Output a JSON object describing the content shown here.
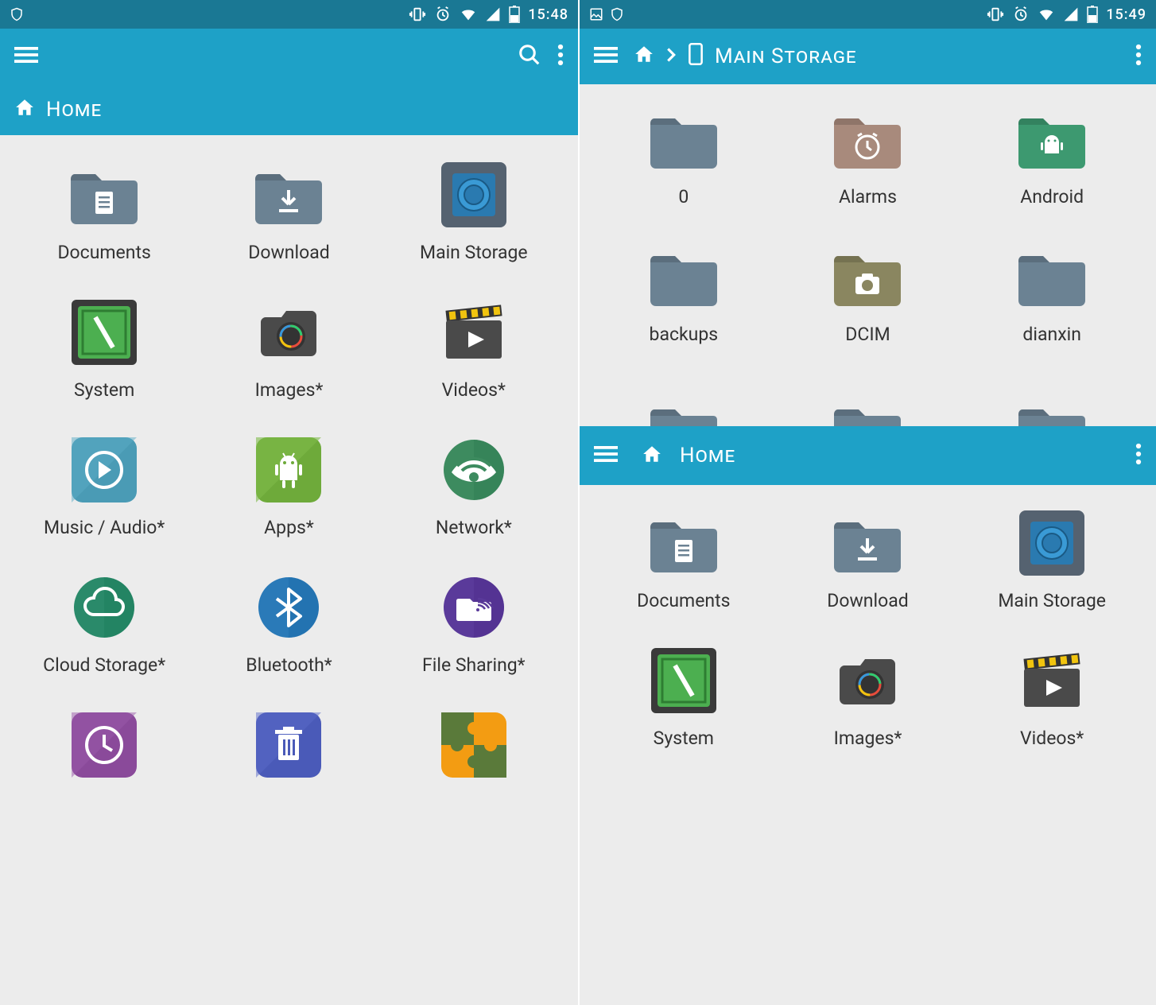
{
  "phone1": {
    "status_time": "15:48",
    "title": "Home",
    "items": [
      {
        "label": "Documents",
        "icon": "folder-doc"
      },
      {
        "label": "Download",
        "icon": "folder-download"
      },
      {
        "label": "Main Storage",
        "icon": "storage"
      },
      {
        "label": "System",
        "icon": "system"
      },
      {
        "label": "Images*",
        "icon": "images"
      },
      {
        "label": "Videos*",
        "icon": "videos"
      },
      {
        "label": "Music / Audio*",
        "icon": "music"
      },
      {
        "label": "Apps*",
        "icon": "apps"
      },
      {
        "label": "Network*",
        "icon": "network"
      },
      {
        "label": "Cloud Storage*",
        "icon": "cloud"
      },
      {
        "label": "Bluetooth*",
        "icon": "bluetooth"
      },
      {
        "label": "File Sharing*",
        "icon": "sharing"
      },
      {
        "label": "",
        "icon": "recent"
      },
      {
        "label": "",
        "icon": "trash"
      },
      {
        "label": "",
        "icon": "plugins"
      }
    ]
  },
  "phone2": {
    "status_time": "15:49",
    "breadcrumb_current": "Main Storage",
    "top_items": [
      {
        "label": "0",
        "icon": "folder"
      },
      {
        "label": "Alarms",
        "icon": "folder-alarm"
      },
      {
        "label": "Android",
        "icon": "folder-android"
      },
      {
        "label": "backups",
        "icon": "folder"
      },
      {
        "label": "DCIM",
        "icon": "folder-dcim"
      },
      {
        "label": "dianxin",
        "icon": "folder"
      },
      {
        "label": "",
        "icon": "folder-partial"
      },
      {
        "label": "",
        "icon": "folder-partial"
      },
      {
        "label": "",
        "icon": "folder-partial"
      }
    ],
    "bottom_title": "Home",
    "bottom_items": [
      {
        "label": "Documents",
        "icon": "folder-doc"
      },
      {
        "label": "Download",
        "icon": "folder-download"
      },
      {
        "label": "Main Storage",
        "icon": "storage"
      },
      {
        "label": "System",
        "icon": "system"
      },
      {
        "label": "Images*",
        "icon": "images"
      },
      {
        "label": "Videos*",
        "icon": "videos"
      }
    ]
  }
}
